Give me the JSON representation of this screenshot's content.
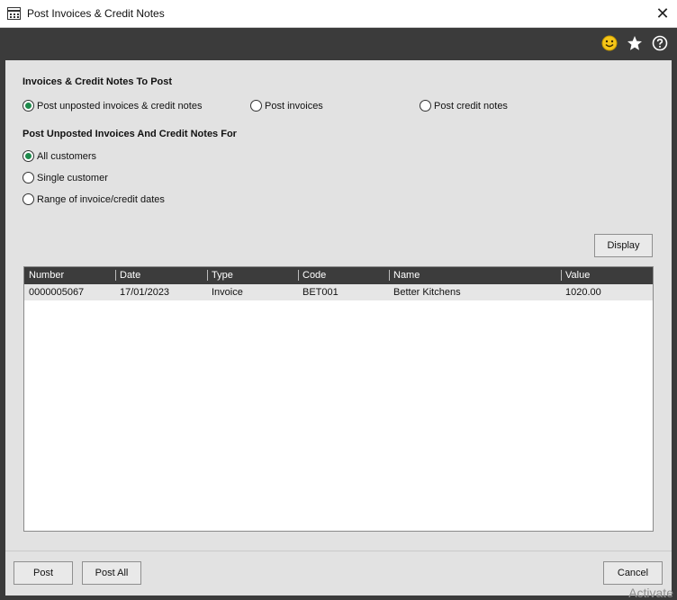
{
  "window": {
    "title": "Post Invoices & Credit Notes",
    "close_glyph": "✕"
  },
  "toolbar": {
    "icons": [
      "smiley-icon",
      "star-icon",
      "help-icon"
    ]
  },
  "section1": {
    "heading": "Invoices & Credit Notes To Post",
    "options": [
      "Post unposted invoices & credit notes",
      "Post invoices",
      "Post credit notes"
    ],
    "selected": "Post unposted invoices & credit notes"
  },
  "section2": {
    "heading": "Post Unposted Invoices And Credit Notes For",
    "options": [
      "All customers",
      "Single customer",
      "Range of invoice/credit dates"
    ],
    "selected": "All customers"
  },
  "display_button": "Display",
  "table": {
    "columns": [
      "Number",
      "Date",
      "Type",
      "Code",
      "Name",
      "Value"
    ],
    "rows": [
      [
        "0000005067",
        "17/01/2023",
        "Invoice",
        "BET001",
        "Better Kitchens",
        "1020.00"
      ]
    ]
  },
  "footer": {
    "post": "Post",
    "post_all": "Post All",
    "cancel": "Cancel"
  },
  "watermark": "Activate",
  "colors": {
    "radio_selected": "#1f8a4c",
    "header_bg": "#3c3c3c",
    "toolbar_bg": "#3b3b3b"
  }
}
